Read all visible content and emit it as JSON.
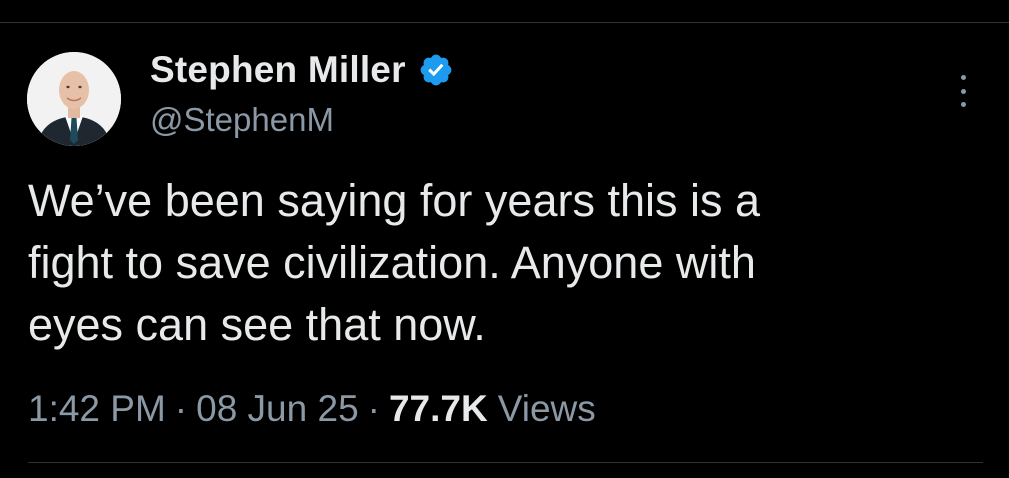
{
  "author": {
    "display_name": "Stephen Miller",
    "handle": "@StephenM",
    "verified": true,
    "verified_color": "#1d9bf0"
  },
  "tweet": {
    "lines": [
      "We’ve been saying for years this is a",
      "fight to save civilization. Anyone with",
      "eyes can see that now."
    ]
  },
  "meta": {
    "time": "1:42 PM",
    "separator": "·",
    "date": "08 Jun 25",
    "views_count": "77.7K",
    "views_label": "Views"
  },
  "icons": {
    "more": "more-options-icon",
    "verified": "verified-badge-icon"
  },
  "colors": {
    "background": "#000000",
    "text_primary": "#e7e9ea",
    "text_secondary": "#8b98a5",
    "divider": "#2f3336"
  }
}
